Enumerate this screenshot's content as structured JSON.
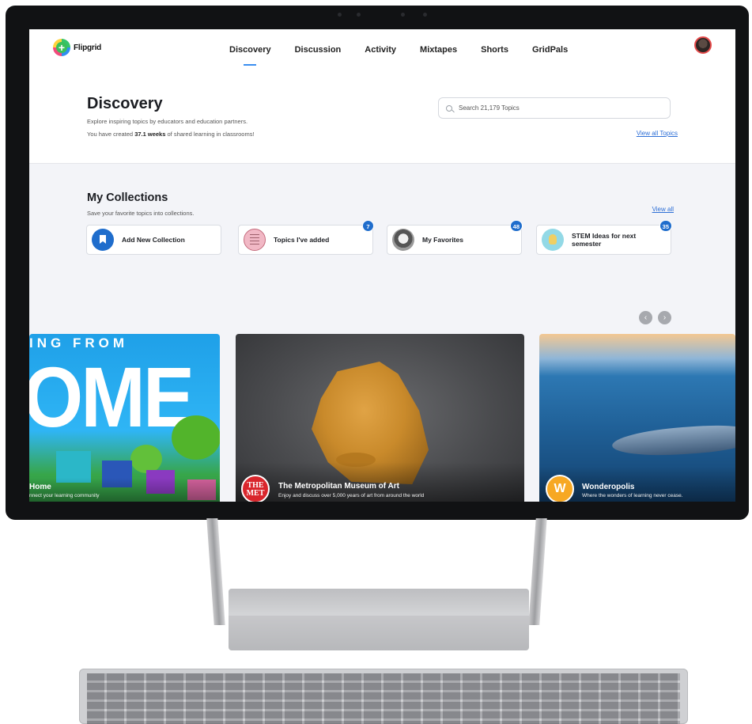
{
  "app": {
    "logo_text": "Flipgrid"
  },
  "nav": {
    "tabs": [
      {
        "label": "Discovery",
        "active": true
      },
      {
        "label": "Discussion",
        "active": false
      },
      {
        "label": "Activity",
        "active": false
      },
      {
        "label": "Mixtapes",
        "active": false
      },
      {
        "label": "Shorts",
        "active": false
      },
      {
        "label": "GridPals",
        "active": false
      }
    ],
    "avatar_icon": "user-avatar-icon"
  },
  "header": {
    "title": "Discovery",
    "subtitle": "Explore inspiring topics by educators and education partners.",
    "created_prefix": "You have created ",
    "created_value": "37.1 weeks",
    "created_suffix": " of shared learning in classrooms!",
    "search_placeholder": "Search 21,179 Topics",
    "view_all_topics": "View all Topics"
  },
  "collections": {
    "title": "My Collections",
    "subtitle": "Save your favorite topics into collections.",
    "view_all": "View all",
    "items": [
      {
        "label": "Add New Collection",
        "icon": "bookmark-icon",
        "badge": ""
      },
      {
        "label": "Topics I've added",
        "icon": "sticker-icon",
        "badge": "7"
      },
      {
        "label": "My Favorites",
        "icon": "dog-icon",
        "badge": "48"
      },
      {
        "label": "STEM Ideas for next semester",
        "icon": "lightbulb-icon",
        "badge": "35"
      }
    ]
  },
  "carousel": {
    "prev_icon": "chevron-left-icon",
    "next_icon": "chevron-right-icon",
    "cards": [
      {
        "banner": "ING FROM",
        "big_text": "OME",
        "title": "Home",
        "description": "nnect your learning community"
      },
      {
        "logo_text": "THE MET",
        "title": "The Metropolitan Museum of Art",
        "description": "Enjoy and discuss over 5,000 years of art from around the world"
      },
      {
        "logo_text": "W",
        "title": "Wonderopolis",
        "description": "Where the wonders of learning never cease."
      }
    ]
  },
  "colors": {
    "accent": "#2e6fd6",
    "badge": "#1f6dcc",
    "met_red": "#d9262c",
    "wonder_orange": "#f7a823"
  }
}
